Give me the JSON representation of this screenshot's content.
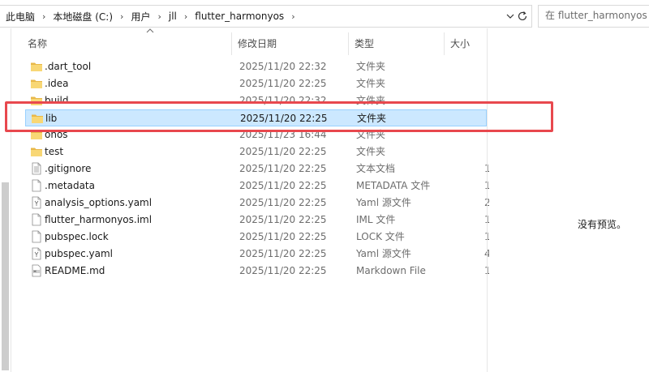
{
  "address_bar": {
    "crumbs": [
      "此电脑",
      "本地磁盘 (C:)",
      "用户",
      "jll",
      "flutter_harmonyos"
    ]
  },
  "search": {
    "placeholder": "在 flutter_harmonyos 中搜索"
  },
  "columns": {
    "name": "名称",
    "date": "修改日期",
    "type": "类型",
    "size": "大小"
  },
  "files": [
    {
      "name": ".dart_tool",
      "date": "2025/11/20 22:32",
      "type": "文件夹",
      "icon": "folder-icon",
      "size": ""
    },
    {
      "name": ".idea",
      "date": "2025/11/20 22:25",
      "type": "文件夹",
      "icon": "folder-icon",
      "size": ""
    },
    {
      "name": "build",
      "date": "2025/11/20 22:32",
      "type": "文件夹",
      "icon": "folder-icon",
      "size": ""
    },
    {
      "name": "lib",
      "date": "2025/11/20 22:25",
      "type": "文件夹",
      "icon": "folder-icon",
      "size": "",
      "selected": true
    },
    {
      "name": "ohos",
      "date": "2025/11/23 16:44",
      "type": "文件夹",
      "icon": "folder-icon",
      "size": ""
    },
    {
      "name": "test",
      "date": "2025/11/20 22:25",
      "type": "文件夹",
      "icon": "folder-icon",
      "size": ""
    },
    {
      "name": ".gitignore",
      "date": "2025/11/20 22:25",
      "type": "文本文档",
      "icon": "text-document-icon",
      "size": "1"
    },
    {
      "name": ".metadata",
      "date": "2025/11/20 22:25",
      "type": "METADATA 文件",
      "icon": "file-icon",
      "size": "1"
    },
    {
      "name": "analysis_options.yaml",
      "date": "2025/11/20 22:25",
      "type": "Yaml 源文件",
      "icon": "yaml-file-icon",
      "size": "2"
    },
    {
      "name": "flutter_harmonyos.iml",
      "date": "2025/11/20 22:25",
      "type": "IML 文件",
      "icon": "file-icon",
      "size": "1"
    },
    {
      "name": "pubspec.lock",
      "date": "2025/11/20 22:25",
      "type": "LOCK 文件",
      "icon": "file-icon",
      "size": "1"
    },
    {
      "name": "pubspec.yaml",
      "date": "2025/11/20 22:25",
      "type": "Yaml 源文件",
      "icon": "yaml-file-icon",
      "size": "4"
    },
    {
      "name": "README.md",
      "date": "2025/11/20 22:25",
      "type": "Markdown File",
      "icon": "markdown-file-icon",
      "size": "1"
    }
  ],
  "preview": {
    "text": "没有预览。"
  },
  "colors": {
    "selection": "#cce8ff",
    "highlight": "#e8484e",
    "folder": "#f8d775"
  }
}
